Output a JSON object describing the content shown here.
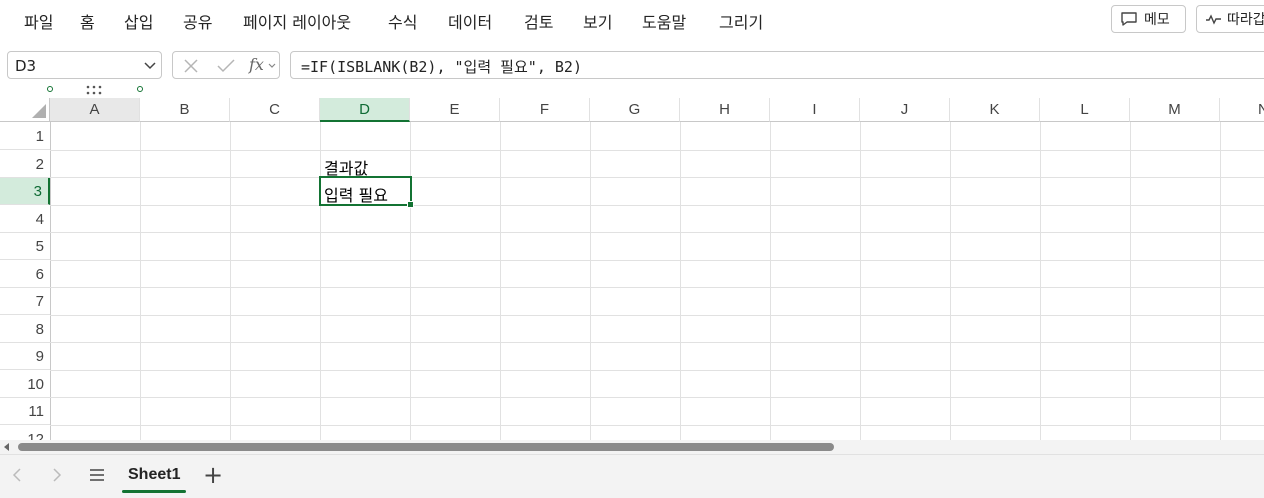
{
  "ribbon": {
    "menu": [
      "파일",
      "홈",
      "삽입",
      "공유",
      "페이지 레이아웃",
      "수식",
      "데이터",
      "검토",
      "보기",
      "도움말",
      "그리기"
    ],
    "memo_label": "메모",
    "follow_label": "따라갑"
  },
  "formula_bar": {
    "name_box": "D3",
    "fx_label": "fx",
    "formula": "=IF(ISBLANK(B2), \"입력 필요\", B2)"
  },
  "grid": {
    "columns": [
      "A",
      "B",
      "C",
      "D",
      "E",
      "F",
      "G",
      "H",
      "I",
      "J",
      "K",
      "L",
      "M",
      "N"
    ],
    "rows": [
      "1",
      "2",
      "3",
      "4",
      "5",
      "6",
      "7",
      "8",
      "9",
      "10",
      "11",
      "12"
    ],
    "selected_column": "D",
    "selected_row": "3",
    "cells": {
      "D2": "결과값",
      "D3": "입력 필요"
    }
  },
  "sheet_tabs": {
    "add_label": "+",
    "sheets": [
      "Sheet1"
    ]
  },
  "colors": {
    "accent": "#137333",
    "selection_header": "#d3ebdc"
  }
}
